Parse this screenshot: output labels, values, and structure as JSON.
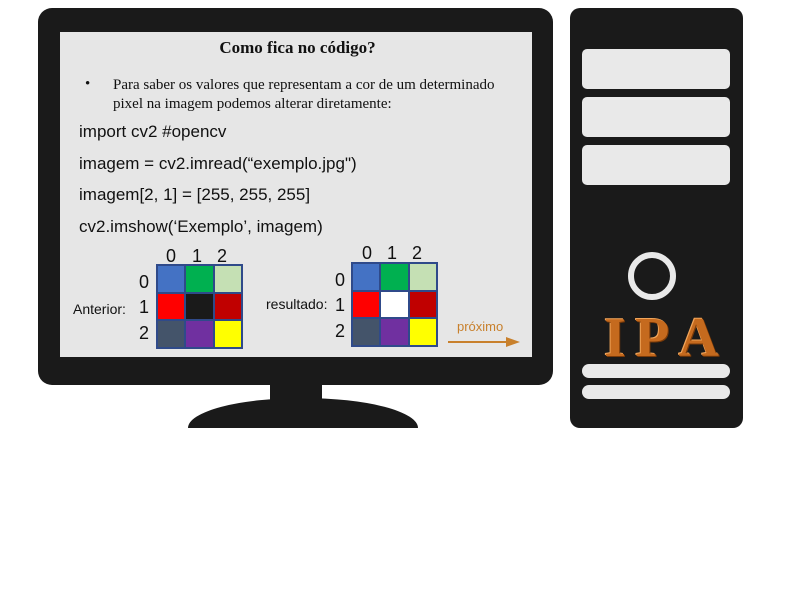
{
  "slide": {
    "title": "Como fica no código?",
    "bullet": "•",
    "bullet_text": "Para saber os valores que representam a cor de um determinado pixel na imagem podemos alterar diretamente:",
    "code_lines": [
      "import cv2 #opencv",
      "imagem = cv2.imread(“exemplo.jpg\")",
      "imagem[2, 1] = [255, 255, 255]",
      "cv2.imshow(‘Exemplo’, imagem)"
    ]
  },
  "grids": {
    "col_labels": [
      "0",
      "1",
      "2"
    ],
    "row_labels": [
      "0",
      "1",
      "2"
    ],
    "before": {
      "label": "Anterior:",
      "colors": [
        "#4472c4",
        "#00b050",
        "#c5e0b4",
        "#ff0000",
        "#1a1a1a",
        "#c00000",
        "#44546a",
        "#7030a0",
        "#ffff00"
      ]
    },
    "after": {
      "label": "resultado:",
      "colors": [
        "#4472c4",
        "#00b050",
        "#c5e0b4",
        "#ff0000",
        "#ffffff",
        "#c00000",
        "#44546a",
        "#7030a0",
        "#ffff00"
      ]
    }
  },
  "navigation": {
    "next_label": "próximo",
    "accent_color": "#c8802c"
  },
  "logo": {
    "letters": [
      "I",
      "P",
      "A"
    ],
    "color": "#c56a1e"
  }
}
